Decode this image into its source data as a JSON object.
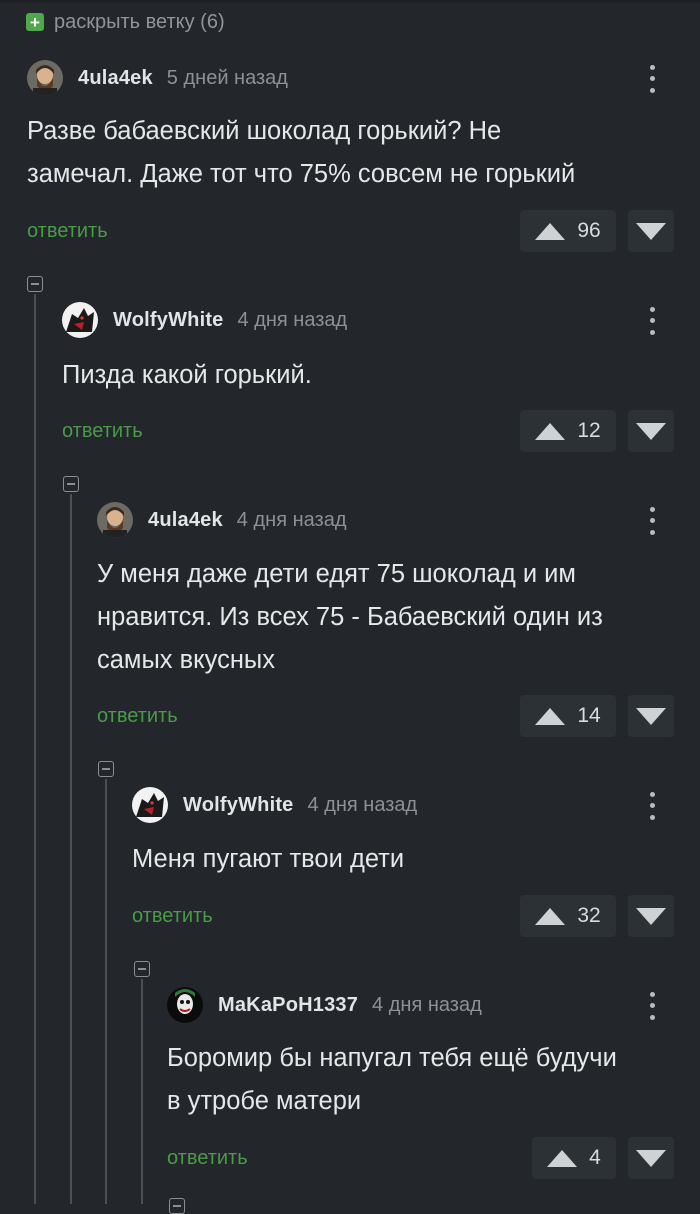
{
  "expand": {
    "icon": "plus-box-icon",
    "label": "раскрыть ветку (6)"
  },
  "comments": [
    {
      "user": "4ula4ek",
      "time": "5 дней назад",
      "text": [
        "Разве бабаевский шоколад горький? Не",
        "замечал. Даже тот что 75% совсем не горький"
      ],
      "reply": "ответить",
      "score": "96",
      "avatar": "bearded-man-avatar"
    },
    {
      "user": "WolfyWhite",
      "time": "4 дня назад",
      "text": [
        "Пизда какой горький."
      ],
      "reply": "ответить",
      "score": "12",
      "avatar": "wolf-avatar"
    },
    {
      "user": "4ula4ek",
      "time": "4 дня назад",
      "text": [
        "У меня даже дети едят 75 шоколад и им",
        "нравится. Из всех 75 - Бабаевский один из",
        "самых вкусных"
      ],
      "reply": "ответить",
      "score": "14",
      "avatar": "bearded-man-avatar"
    },
    {
      "user": "WolfyWhite",
      "time": "4 дня назад",
      "text": [
        "Меня пугают твои дети"
      ],
      "reply": "ответить",
      "score": "32",
      "avatar": "wolf-avatar"
    },
    {
      "user": "MaKaPoH1337",
      "time": "4 дня назад",
      "text": [
        "Боромир бы напугал тебя ещё будучи",
        "в утробе матери"
      ],
      "reply": "ответить",
      "score": "4",
      "avatar": "joker-avatar"
    }
  ],
  "colors": {
    "background": "#23272b",
    "reply": "#4a9a4a",
    "expand_icon": "#4fa84a"
  }
}
